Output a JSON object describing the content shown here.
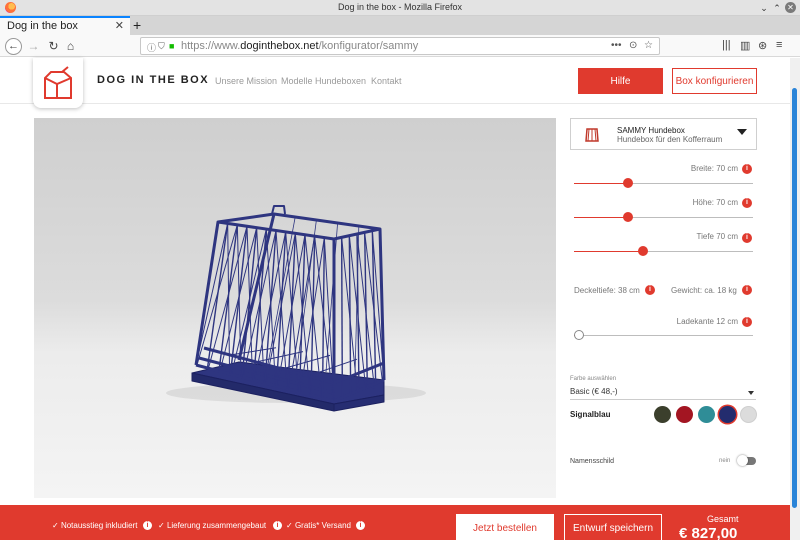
{
  "window": {
    "title": "Dog in the box - Mozilla Firefox"
  },
  "browser": {
    "tab_title": "Dog in the box",
    "url_prefix": "https://www.",
    "url_domain": "doginthebox.net",
    "url_path": "/konfigurator/sammy"
  },
  "site": {
    "brand": "DOG IN THE BOX",
    "nav": [
      "Unsere Mission",
      "Modelle Hundeboxen",
      "Kontakt"
    ],
    "help_label": "Hilfe",
    "configure_label": "Box konfigurieren"
  },
  "product": {
    "name": "SAMMY Hundebox",
    "subtitle": "Hundebox für den Kofferraum"
  },
  "params": {
    "breite": {
      "label": "Breite: 70 cm",
      "level": 0.29
    },
    "hoehe": {
      "label": "Höhe: 70 cm",
      "level": 0.29
    },
    "tiefe": {
      "label": "Tiefe 70 cm",
      "level": 0.38
    },
    "deckeltiefe": "Deckeltiefe: 38 cm",
    "gewicht": "Gewicht: ca. 18 kg",
    "ladekante": {
      "label": "Ladekante 12 cm",
      "level": 0.0
    }
  },
  "color": {
    "caption": "Farbe auswählen",
    "selected_option": "Basic (€ 48,-)",
    "selected_name": "Signalblau",
    "swatches": [
      "#3b3f2c",
      "#a31522",
      "#2f8d97",
      "#232c6e",
      "#dcdcdc"
    ],
    "selected_index": 3,
    "box_color": "#2e3580"
  },
  "namensschild": {
    "label": "Namensschild",
    "state": "nein"
  },
  "footer": {
    "features": [
      "Notausstieg inkludiert",
      "Lieferung zusammengebaut",
      "Gratis* Versand"
    ],
    "order_label": "Jetzt bestellen",
    "save_label": "Entwurf speichern",
    "total_label": "Gesamt",
    "total_value": "€ 827,00"
  },
  "theme": {
    "accent": "#e03a2e"
  }
}
